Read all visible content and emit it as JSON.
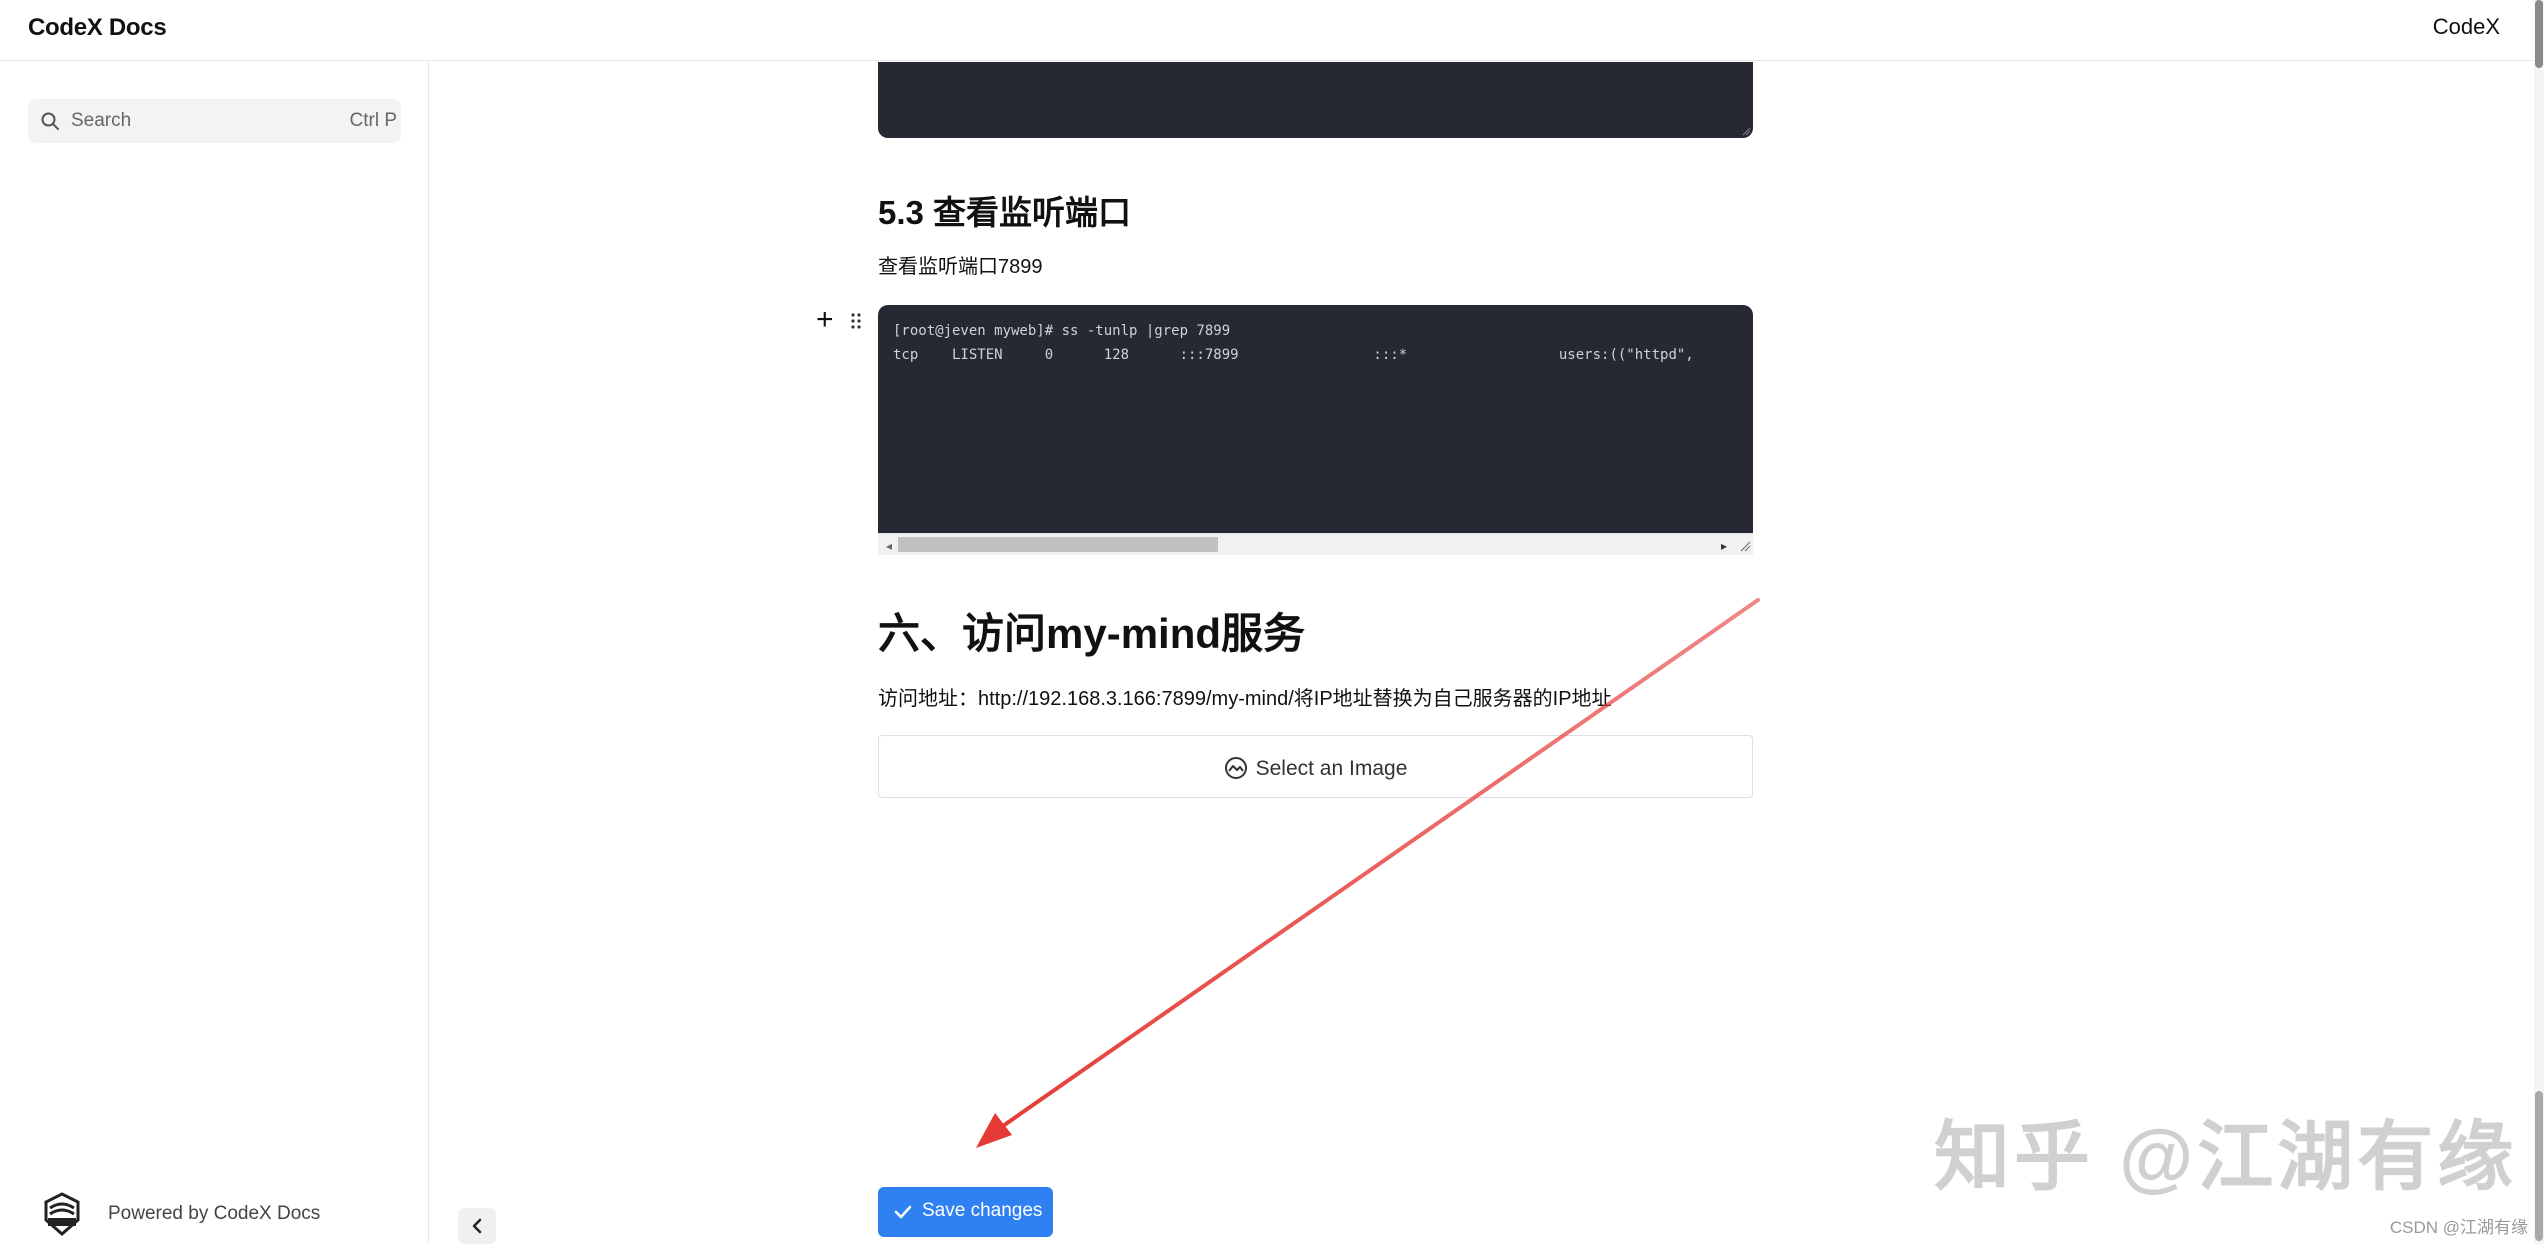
{
  "header": {
    "brand": "CodeX Docs",
    "nav_right": "CodeX"
  },
  "sidebar": {
    "search": {
      "placeholder": "Search",
      "shortcut": "Ctrl P"
    },
    "powered_by": "Powered by CodeX Docs"
  },
  "content": {
    "section_5_3_title": "5.3 查看监听端口",
    "section_5_3_text": "查看监听端口7899",
    "code_lines": [
      "[root@jeven myweb]# ss -tunlp |grep 7899",
      "tcp    LISTEN     0      128      :::7899                :::*                  users:((\"httpd\","
    ],
    "section_6_title": "六、访问my-mind服务",
    "section_6_label": "访问地址：",
    "section_6_address": "http://192.168.3.166:7899/my-mind/将IP地址替换为自己服务器的IP地址",
    "image_picker_label": "Select an Image",
    "save_button": "Save changes"
  },
  "watermarks": {
    "zhihu": "知乎 @江湖有缘",
    "csdn": "CSDN @江湖有缘"
  },
  "colors": {
    "accent": "#2f80f0",
    "code_bg": "#262833",
    "annotation_arrow": "#e53935"
  },
  "icons": [
    "search-icon",
    "codex-logo-icon",
    "chevron-left-icon",
    "plus-icon",
    "drag-handle-icon",
    "image-icon",
    "check-icon"
  ]
}
